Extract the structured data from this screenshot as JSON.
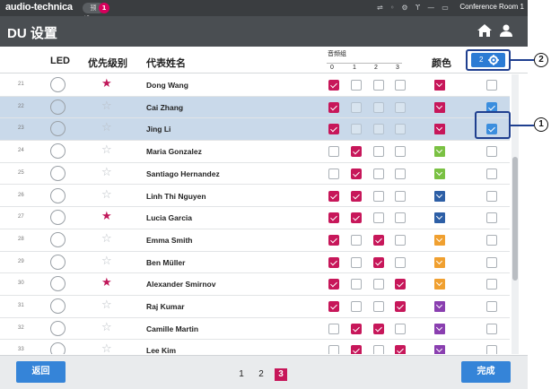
{
  "status_bar": {
    "brand": "audio-technica",
    "pill_label": "预设",
    "pill_count": "1",
    "room": "Conference Room 1"
  },
  "title_bar": {
    "title": "DU 设置",
    "home_icon": "home-icon",
    "user_icon": "user-icon"
  },
  "header": {
    "led": "LED",
    "priority": "优先级别",
    "name": "代表姓名",
    "audio_group": "音频组",
    "group_cols": [
      "0",
      "1",
      "2",
      "3"
    ],
    "color": "颜色",
    "settings_count": "2"
  },
  "rows": [
    {
      "num": "21",
      "star": true,
      "name": "Dong Wang",
      "groups": [
        true,
        false,
        false,
        false
      ],
      "color": "#c7175a",
      "checked": false,
      "selected": false
    },
    {
      "num": "22",
      "star": false,
      "name": "Cai Zhang",
      "groups": [
        true,
        false,
        false,
        false
      ],
      "color": "#c7175a",
      "checked": true,
      "selected": true
    },
    {
      "num": "23",
      "star": false,
      "name": "Jing Li",
      "groups": [
        true,
        false,
        false,
        false
      ],
      "color": "#c7175a",
      "checked": true,
      "selected": true
    },
    {
      "num": "24",
      "star": false,
      "name": "Maria Gonzalez",
      "groups": [
        false,
        true,
        false,
        false
      ],
      "color": "#7ac143",
      "checked": false,
      "selected": false
    },
    {
      "num": "25",
      "star": false,
      "name": "Santiago Hernandez",
      "groups": [
        false,
        true,
        false,
        false
      ],
      "color": "#7ac143",
      "checked": false,
      "selected": false
    },
    {
      "num": "26",
      "star": false,
      "name": "Linh Thi Nguyen",
      "groups": [
        true,
        true,
        false,
        false
      ],
      "color": "#2d5fa6",
      "checked": false,
      "selected": false
    },
    {
      "num": "27",
      "star": true,
      "name": "Lucia Garcia",
      "groups": [
        true,
        true,
        false,
        false
      ],
      "color": "#2d5fa6",
      "checked": false,
      "selected": false
    },
    {
      "num": "28",
      "star": false,
      "name": "Emma Smith",
      "groups": [
        true,
        false,
        true,
        false
      ],
      "color": "#f0a030",
      "checked": false,
      "selected": false
    },
    {
      "num": "29",
      "star": false,
      "name": "Ben Müller",
      "groups": [
        true,
        false,
        true,
        false
      ],
      "color": "#f0a030",
      "checked": false,
      "selected": false
    },
    {
      "num": "30",
      "star": true,
      "name": "Alexander Smirnov",
      "groups": [
        true,
        false,
        false,
        true
      ],
      "color": "#f0a030",
      "checked": false,
      "selected": false
    },
    {
      "num": "31",
      "star": false,
      "name": "Raj Kumar",
      "groups": [
        true,
        false,
        false,
        true
      ],
      "color": "#8a3fb0",
      "checked": false,
      "selected": false
    },
    {
      "num": "32",
      "star": false,
      "name": "Camille Martin",
      "groups": [
        false,
        true,
        true,
        false
      ],
      "color": "#8a3fb0",
      "checked": false,
      "selected": false
    },
    {
      "num": "33",
      "star": false,
      "name": "Lee Kim",
      "groups": [
        false,
        true,
        false,
        true
      ],
      "color": "#8a3fb0",
      "checked": false,
      "selected": false
    }
  ],
  "footer": {
    "back": "返回",
    "done": "完成",
    "pages": [
      "1",
      "2",
      "3"
    ],
    "current_page": "3"
  },
  "callouts": {
    "one": "1",
    "two": "2"
  }
}
